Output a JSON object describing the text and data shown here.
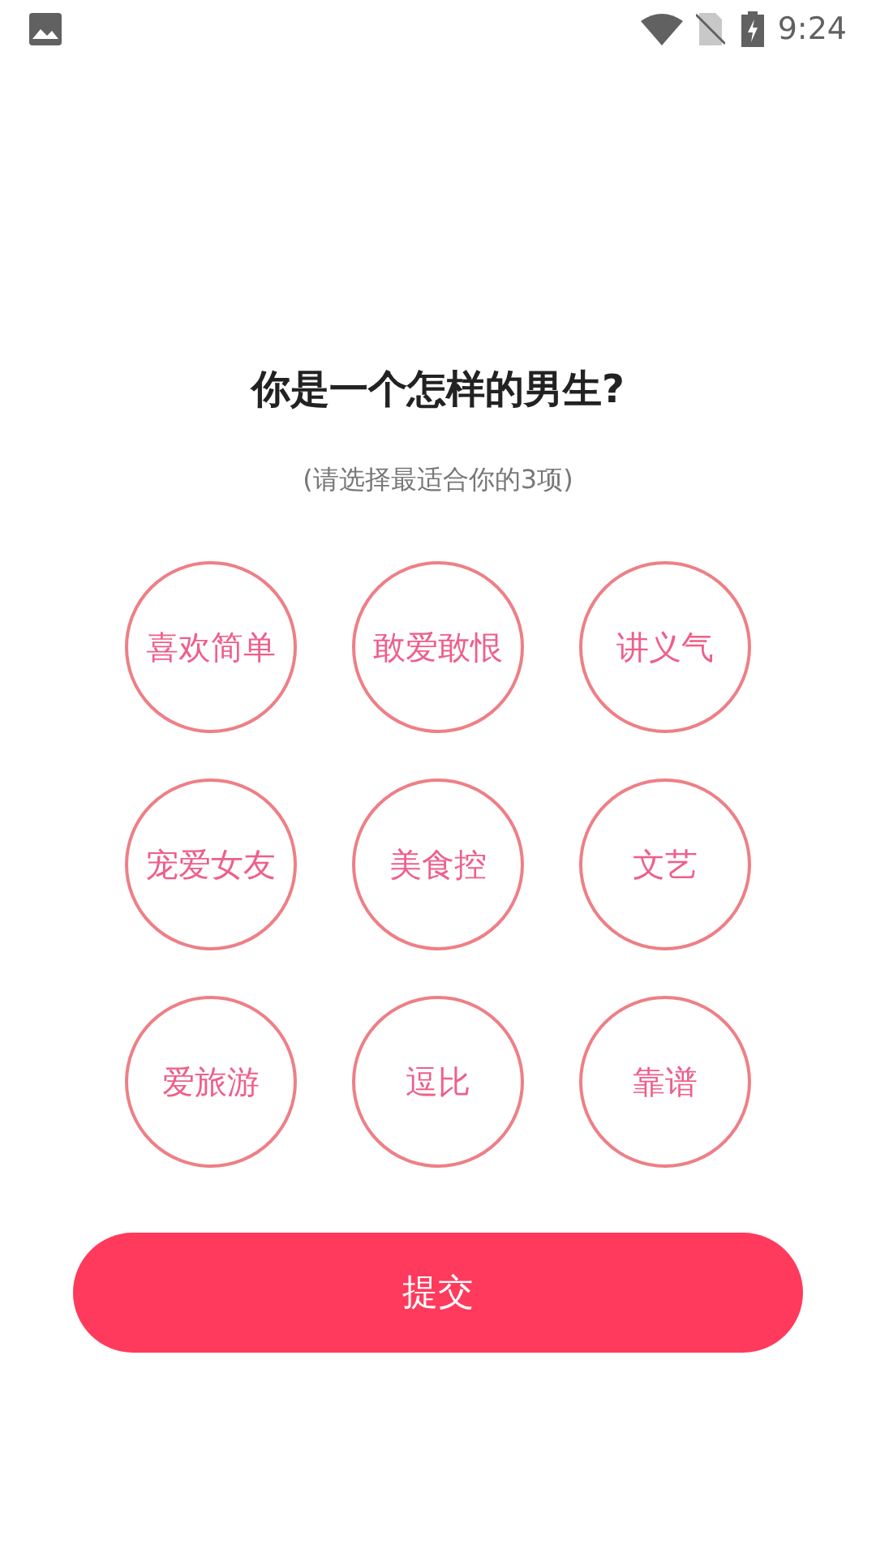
{
  "status_bar": {
    "time": "9:24"
  },
  "title": "你是一个怎样的男生?",
  "subtitle": "(请选择最适合你的3项)",
  "options": [
    {
      "label": "喜欢简单",
      "selected": false
    },
    {
      "label": "敢爱敢恨",
      "selected": false
    },
    {
      "label": "讲义气",
      "selected": false
    },
    {
      "label": "宠爱女友",
      "selected": false
    },
    {
      "label": "美食控",
      "selected": false
    },
    {
      "label": "文艺",
      "selected": false
    },
    {
      "label": "爱旅游",
      "selected": false
    },
    {
      "label": "逗比",
      "selected": false
    },
    {
      "label": "靠谱",
      "selected": false
    }
  ],
  "submit_button": "提交"
}
